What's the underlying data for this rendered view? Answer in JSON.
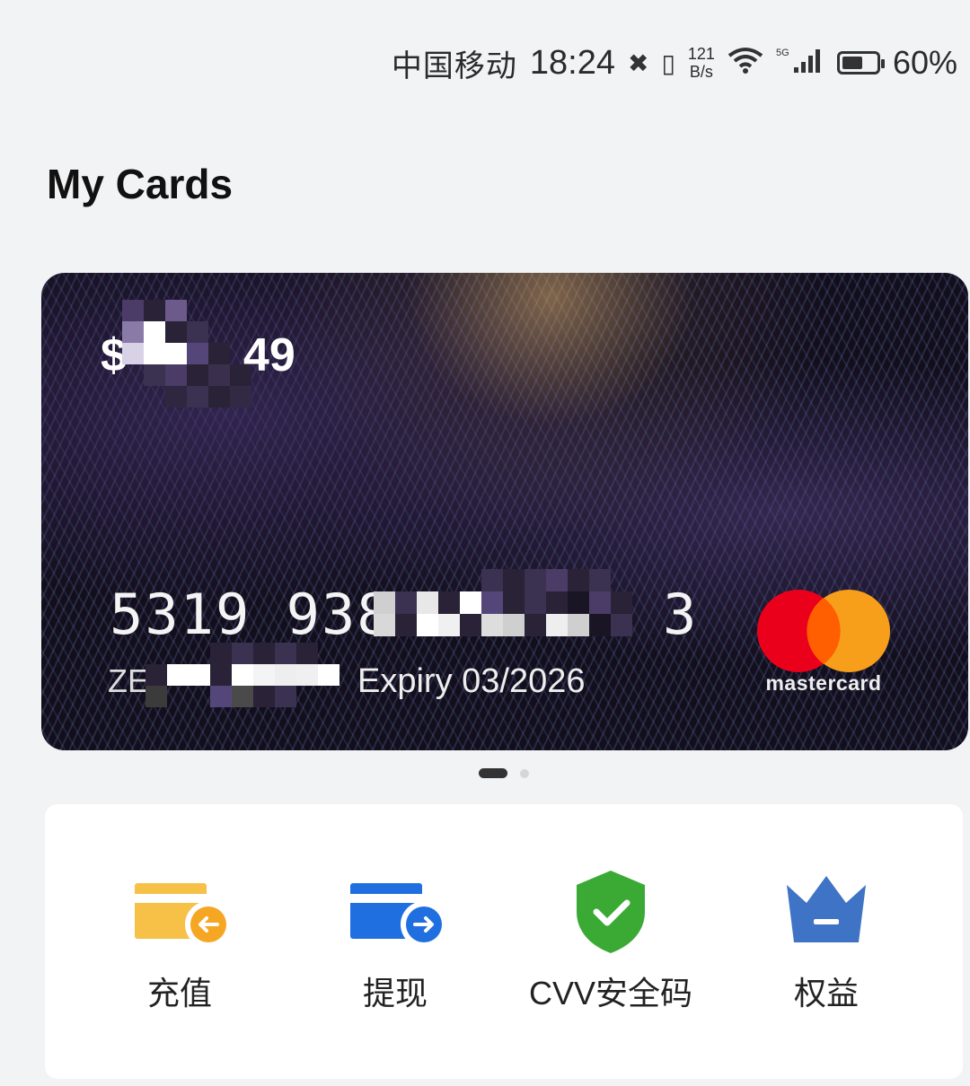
{
  "status_bar": {
    "carrier": "中国移动",
    "time": "18:24",
    "net_speed_value": "121",
    "net_speed_unit": "B/s",
    "signal_label": "5G",
    "battery_percent": "60%",
    "battery_level": 0.6
  },
  "page": {
    "title": "My Cards"
  },
  "card": {
    "balance_prefix": "$",
    "balance_suffix": "49",
    "number_start": "5319 938",
    "number_end": "3",
    "holder_prefix": "ZE",
    "expiry": "Expiry 03/2026",
    "network": "mastercard"
  },
  "pager": {
    "count": 2,
    "active_index": 0
  },
  "actions": [
    {
      "label": "充值",
      "icon": "card-topup-icon",
      "color": "#f7c046"
    },
    {
      "label": "提现",
      "icon": "card-withdraw-icon",
      "color": "#1f6fe0"
    },
    {
      "label": "CVV安全码",
      "icon": "shield-check-icon",
      "color": "#3aaa35"
    },
    {
      "label": "权益",
      "icon": "crown-icon",
      "color": "#3f73c5"
    }
  ]
}
